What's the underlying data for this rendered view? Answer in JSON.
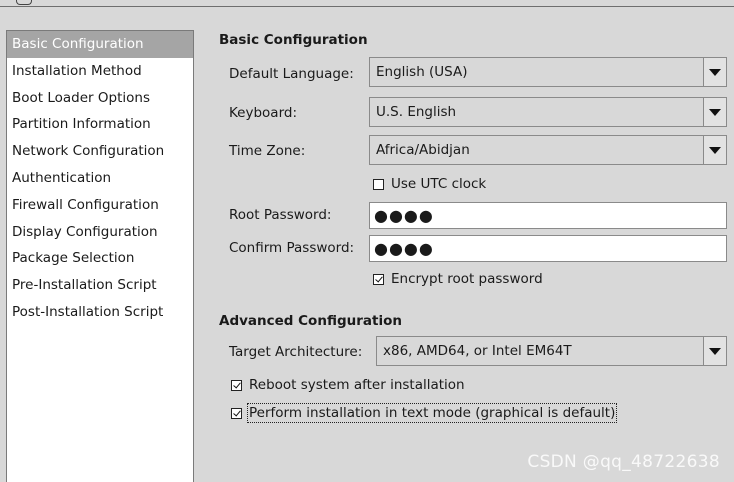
{
  "sidebar": {
    "items": [
      {
        "label": "Basic Configuration",
        "selected": true
      },
      {
        "label": "Installation Method"
      },
      {
        "label": "Boot Loader Options"
      },
      {
        "label": "Partition Information"
      },
      {
        "label": "Network Configuration"
      },
      {
        "label": "Authentication"
      },
      {
        "label": "Firewall Configuration"
      },
      {
        "label": "Display Configuration"
      },
      {
        "label": "Package Selection"
      },
      {
        "label": "Pre-Installation Script"
      },
      {
        "label": "Post-Installation Script"
      }
    ]
  },
  "basic": {
    "title": "Basic Configuration",
    "language_label": "Default Language:",
    "language_value": "English (USA)",
    "keyboard_label": "Keyboard:",
    "keyboard_value": "U.S. English",
    "timezone_label": "Time Zone:",
    "timezone_value": "Africa/Abidjan",
    "utc_label": "Use UTC clock",
    "utc_checked": false,
    "root_pw_label": "Root Password:",
    "root_pw_value": "●●●●",
    "confirm_pw_label": "Confirm Password:",
    "confirm_pw_value": "●●●●",
    "encrypt_label": "Encrypt root password",
    "encrypt_checked": true
  },
  "advanced": {
    "title": "Advanced Configuration",
    "arch_label": "Target Architecture:",
    "arch_value": "x86, AMD64, or Intel EM64T",
    "reboot_label": "Reboot system after installation",
    "reboot_checked": true,
    "textmode_label": "Perform installation in text mode (graphical is default)",
    "textmode_checked": true
  },
  "watermark": "CSDN @qq_48722638",
  "icons": {
    "dropdown": "chevron-down-icon",
    "checkbox": "checkbox-icon"
  },
  "colors": {
    "window_bg": "#d8d8d8",
    "selection_bg": "#a5a5a5",
    "list_bg": "#ffffff"
  }
}
